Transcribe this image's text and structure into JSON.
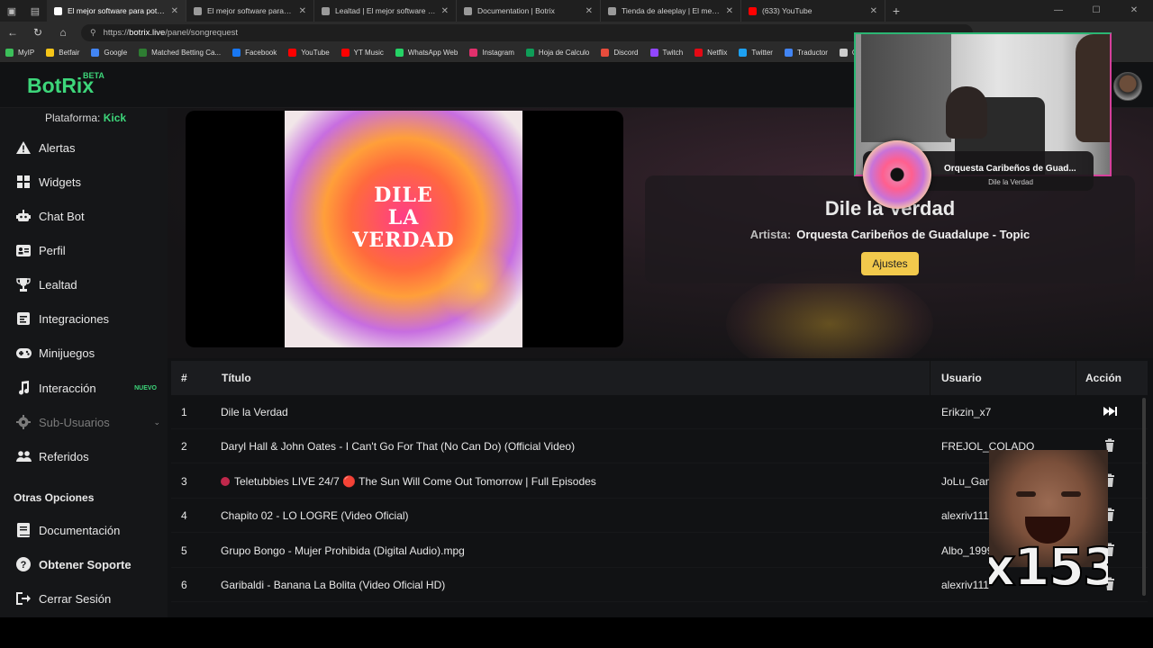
{
  "browser": {
    "tabs": [
      {
        "label": "El mejor software para poten",
        "color": "#ffffff",
        "active": true
      },
      {
        "label": "El mejor software para potenciar",
        "color": "#9a9a9a"
      },
      {
        "label": "Lealtad | El mejor software para p",
        "color": "#9a9a9a"
      },
      {
        "label": "Documentation | Botrix",
        "color": "#9a9a9a"
      },
      {
        "label": "Tienda de aleeplay | El mejor softw",
        "color": "#9a9a9a"
      },
      {
        "label": "(633) YouTube",
        "color": "#ff0000"
      }
    ],
    "url_prefix": "https://",
    "url_host": "botrix.live",
    "url_path": "/panel/songrequest",
    "bookmarks": [
      {
        "label": "MyIP",
        "color": "#3cbf5a"
      },
      {
        "label": "Betfair",
        "color": "#f5c518"
      },
      {
        "label": "Google",
        "color": "#4285f4"
      },
      {
        "label": "Matched Betting Ca...",
        "color": "#2e7d32"
      },
      {
        "label": "Facebook",
        "color": "#1877f2"
      },
      {
        "label": "YouTube",
        "color": "#ff0000"
      },
      {
        "label": "YT Music",
        "color": "#ff0000"
      },
      {
        "label": "WhatsApp Web",
        "color": "#25d366"
      },
      {
        "label": "Instagram",
        "color": "#e1306c"
      },
      {
        "label": "Hoja de Calculo",
        "color": "#0f9d58"
      },
      {
        "label": "Discord",
        "color": "#e74c3c"
      },
      {
        "label": "Twitch",
        "color": "#9146ff"
      },
      {
        "label": "Netflix",
        "color": "#e50914"
      },
      {
        "label": "Twitter",
        "color": "#1da1f2"
      },
      {
        "label": "Traductor",
        "color": "#4285f4"
      },
      {
        "label": "Cinepl",
        "color": "#cccccc"
      }
    ]
  },
  "app": {
    "logo": "BotRix",
    "logo_badge": "BETA",
    "platform_label": "Plataforma:",
    "platform_value": "Kick",
    "nav": [
      {
        "label": "Alertas",
        "icon": "alert-icon"
      },
      {
        "label": "Widgets",
        "icon": "grid-icon"
      },
      {
        "label": "Chat Bot",
        "icon": "robot-icon"
      },
      {
        "label": "Perfil",
        "icon": "profile-card-icon"
      },
      {
        "label": "Lealtad",
        "icon": "trophy-icon"
      },
      {
        "label": "Integraciones",
        "icon": "integration-icon"
      },
      {
        "label": "Minijuegos",
        "icon": "gamepad-icon"
      },
      {
        "label": "Interacción",
        "icon": "music-note-icon",
        "badge": "NUEVO"
      },
      {
        "label": "Sub-Usuarios",
        "icon": "gear-icon",
        "disabled": true
      },
      {
        "label": "Referidos",
        "icon": "users-icon"
      }
    ],
    "other_title": "Otras Opciones",
    "other": [
      {
        "label": "Documentación",
        "icon": "book-icon"
      },
      {
        "label": "Obtener Soporte",
        "icon": "help-icon"
      },
      {
        "label": "Cerrar Sesión",
        "icon": "logout-icon"
      }
    ]
  },
  "player": {
    "cover_text": "DILE LA VERDAD",
    "title": "Dile la Verdad",
    "artist_label": "Artista:",
    "artist": "Orquesta Caribeños de Guadalupe - Topic",
    "settings_button": "Ajustes"
  },
  "queue": {
    "headers": {
      "number": "#",
      "title": "Título",
      "user": "Usuario",
      "action": "Acción"
    },
    "rows": [
      {
        "n": "1",
        "title": "Dile la Verdad",
        "user": "Erikzin_x7",
        "action": "skip-icon"
      },
      {
        "n": "2",
        "title": "Daryl Hall & John Oates - I Can't Go For That (No Can Do) (Official Video)",
        "user": "FREJOL_COLADO",
        "action": "trash-icon"
      },
      {
        "n": "3",
        "title": "Teletubbies LIVE 24/7 🔴 The Sun Will Come Out Tomorrow | Full Episodes",
        "user": "JoLu_Gam",
        "action": "trash-icon",
        "dot": true
      },
      {
        "n": "4",
        "title": "Chapito 02 - LO LOGRE (Video Oficial)",
        "user": "alexriv111",
        "action": "trash-icon"
      },
      {
        "n": "5",
        "title": "Grupo Bongo - Mujer Prohibida (Digital Audio).mpg",
        "user": "Albo_1999",
        "action": "trash-icon"
      },
      {
        "n": "6",
        "title": "Garibaldi - Banana La Bolita (Video Oficial HD)",
        "user": "alexriv111",
        "action": "trash-icon"
      }
    ]
  },
  "overlay": {
    "now_playing_title": "Orquesta Caribeños de Guad...",
    "now_playing_sub": "Dile la Verdad",
    "meme_counter": "x153"
  }
}
